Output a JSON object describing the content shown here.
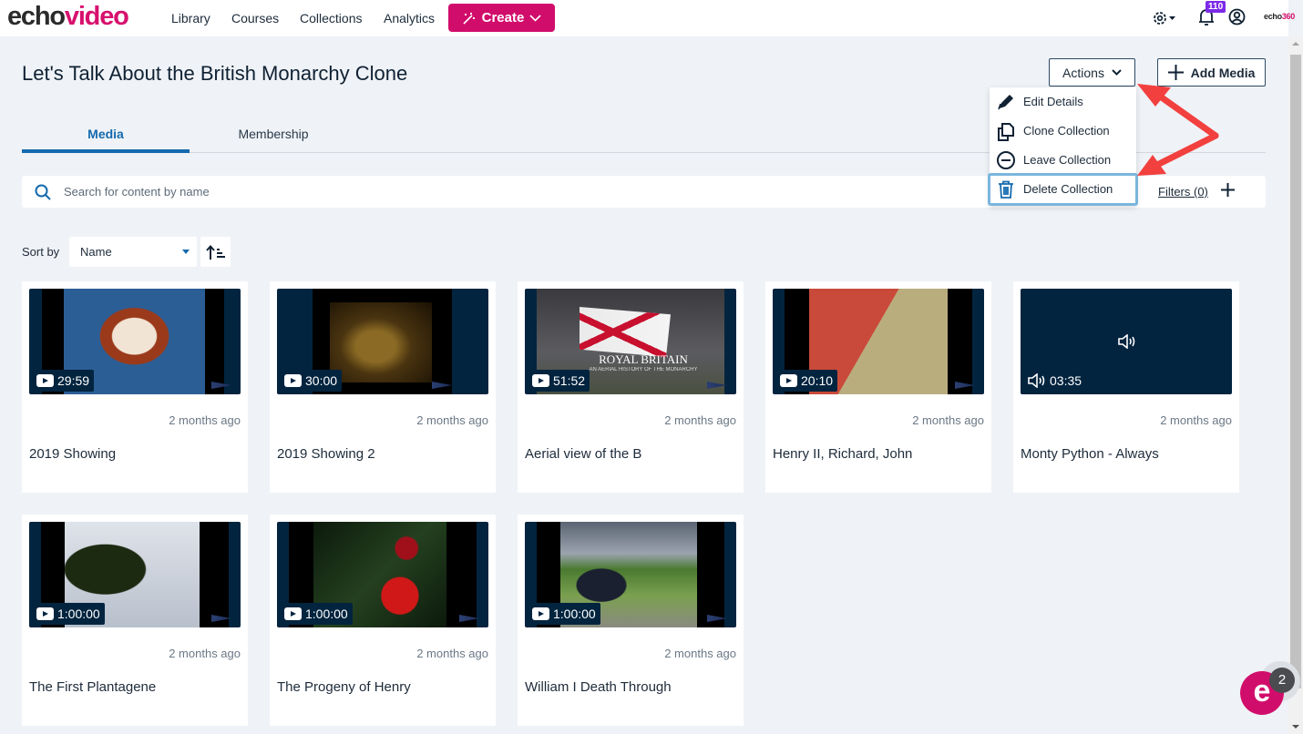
{
  "app": {
    "logo_part1": "echo",
    "logo_part2": "video",
    "brand_color": "#d10d6b",
    "nav": [
      {
        "label": "Library"
      },
      {
        "label": "Courses"
      },
      {
        "label": "Collections"
      },
      {
        "label": "Analytics"
      }
    ],
    "create_label": "Create",
    "notifications_count": "110",
    "echo360_logo_part1": "echo",
    "echo360_logo_part2": "360"
  },
  "page": {
    "title": "Let's Talk About the British Monarchy Clone",
    "actions_label": "Actions",
    "add_media_label": "Add Media"
  },
  "actions_menu": {
    "items": [
      {
        "label": "Edit Details",
        "icon": "pencil-icon"
      },
      {
        "label": "Clone Collection",
        "icon": "copy-icon"
      },
      {
        "label": "Leave Collection",
        "icon": "minus-circle-icon"
      },
      {
        "label": "Delete Collection",
        "icon": "trash-icon",
        "focused": true
      }
    ]
  },
  "tabs": [
    {
      "label": "Media",
      "active": true
    },
    {
      "label": "Membership",
      "active": false
    }
  ],
  "search": {
    "placeholder": "Search for content by name",
    "value": "",
    "filters_label": "Filters (0)"
  },
  "sort": {
    "label": "Sort by",
    "selected": "Name"
  },
  "media": [
    {
      "title": "2019 Showing",
      "duration": "29:59",
      "date": "2 months ago",
      "type": "video"
    },
    {
      "title": "2019 Showing 2",
      "duration": "30:00",
      "date": "2 months ago",
      "type": "video"
    },
    {
      "title": "Aerial view of the B",
      "duration": "51:52",
      "date": "2 months ago",
      "type": "video",
      "overlay_title": "ROYAL BRITAIN",
      "overlay_subtitle": "AN AERIAL HISTORY OF THE MONARCHY"
    },
    {
      "title": "Henry II, Richard, John",
      "duration": "20:10",
      "date": "2 months ago",
      "type": "video"
    },
    {
      "title": "Monty Python - Always",
      "duration": "03:35",
      "date": "2 months ago",
      "type": "audio"
    },
    {
      "title": "The First Plantagene",
      "duration": "1:00:00",
      "date": "2 months ago",
      "type": "video"
    },
    {
      "title": "The Progeny of Henry",
      "duration": "1:00:00",
      "date": "2 months ago",
      "type": "video"
    },
    {
      "title": "William I Death Through",
      "duration": "1:00:00",
      "date": "2 months ago",
      "type": "video"
    }
  ],
  "chat": {
    "letter": "e",
    "badge_count": "2"
  }
}
